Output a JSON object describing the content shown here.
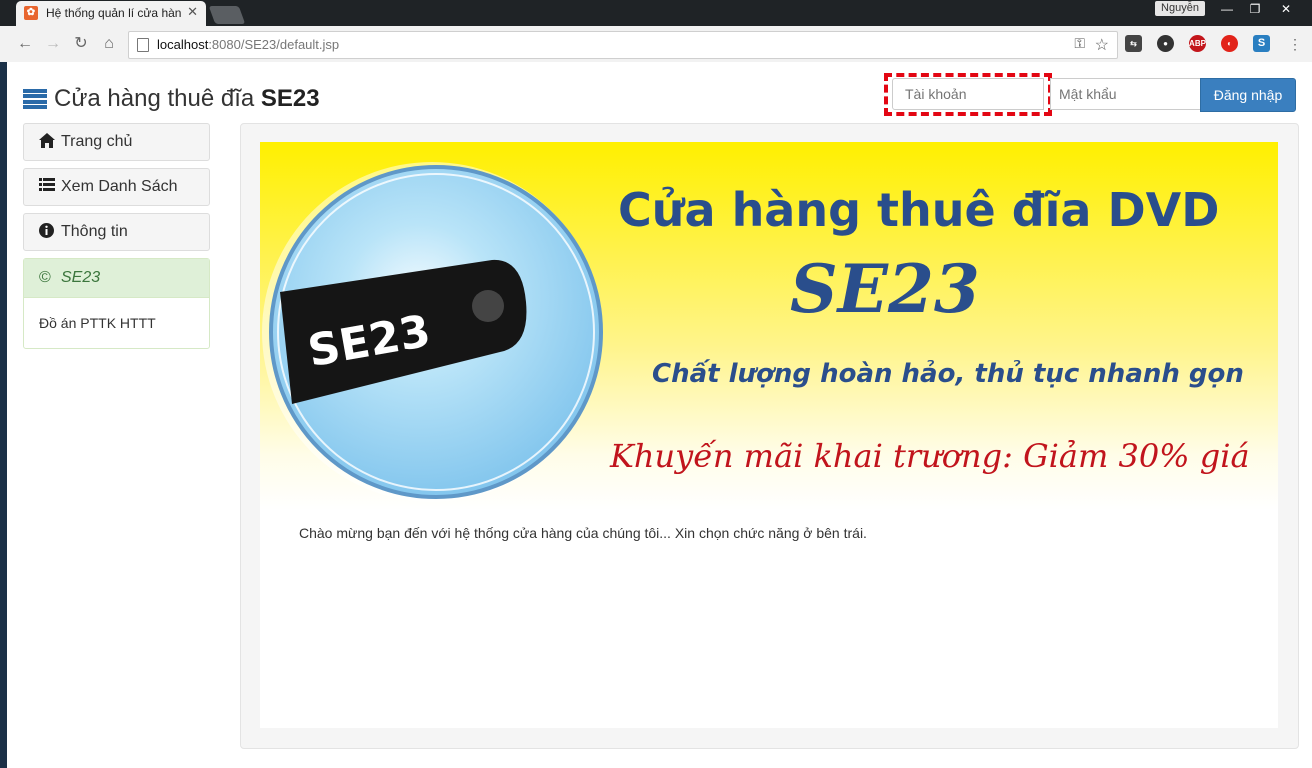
{
  "browser": {
    "tab_title": "Hệ thống quản lí cửa hàn",
    "profile_name": "Nguyễn",
    "url_host": "localhost",
    "url_rest": ":8080/SE23/default.jsp",
    "window_buttons": {
      "minimize": "—",
      "restore": "❐",
      "close": "✕"
    },
    "extensions": [
      "cast-icon",
      "chat-icon",
      "ABP",
      "opera-icon",
      "S"
    ]
  },
  "header": {
    "brand_prefix": "Cửa hàng thuê đĩa ",
    "brand_bold": "SE23",
    "username_placeholder": "Tài khoản",
    "password_placeholder": "Mật khẩu",
    "login_label": "Đăng nhập"
  },
  "sidebar": {
    "items": [
      {
        "icon": "home-icon",
        "label": "Trang chủ"
      },
      {
        "icon": "list-icon",
        "label": "Xem Danh Sách"
      },
      {
        "icon": "info-icon",
        "label": "Thông tin"
      }
    ],
    "panel_title": "SE23",
    "panel_body": "Đồ án PTTK HTTT"
  },
  "banner": {
    "disc_label": "SE23",
    "line1": "Cửa hàng thuê đĩa DVD",
    "line2": "SE23",
    "line3": "Chất lượng hoàn hảo, thủ tục nhanh gọn",
    "line4": "Khuyến mãi khai trương: Giảm 30% giá",
    "colors": {
      "title": "#2a4e8c",
      "promo": "#c1141c"
    }
  },
  "main": {
    "welcome_text": "Chào mừng bạn đến với hệ thống cửa hàng của chúng tôi... Xin chọn chức năng ở bên trái."
  }
}
